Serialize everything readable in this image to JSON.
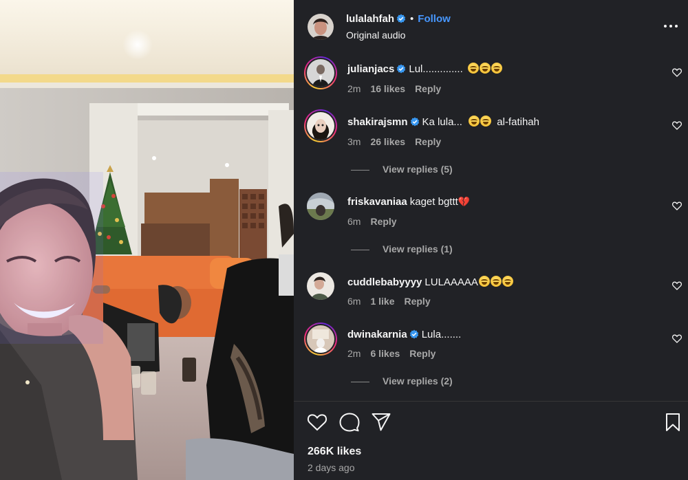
{
  "post": {
    "author": "lulalahfah",
    "author_verified": true,
    "follow_label": "Follow",
    "separator": "•",
    "audio": "Original audio"
  },
  "comments": [
    {
      "username": "julianjacs",
      "verified": true,
      "text": "Lul..............",
      "emojis": 3,
      "time": "2m",
      "likes": "16 likes",
      "reply": "Reply",
      "story_ring": true
    },
    {
      "username": "shakirajsmn",
      "verified": true,
      "text": "Ka lula...",
      "emojis": 2,
      "text_after": "al-fatihah",
      "time": "3m",
      "likes": "26 likes",
      "reply": "Reply",
      "view_replies": "View replies (5)",
      "story_ring": true
    },
    {
      "username": "friskavaniaa",
      "verified": false,
      "text": "kaget bgttt",
      "broken_heart": true,
      "time": "6m",
      "reply": "Reply",
      "view_replies": "View replies (1)",
      "story_ring": false
    },
    {
      "username": "cuddlebabyyyy",
      "verified": false,
      "text": "LULAAAAA",
      "emojis": 3,
      "time": "6m",
      "likes": "1 like",
      "reply": "Reply",
      "story_ring": false
    },
    {
      "username": "dwinakarnia",
      "verified": true,
      "text": "Lula.......",
      "time": "2m",
      "likes": "6 likes",
      "reply": "Reply",
      "view_replies": "View replies (2)",
      "story_ring": true
    }
  ],
  "footer": {
    "likes": "266K likes",
    "posted": "2 days ago"
  },
  "icons": [
    "more-icon",
    "heart-icon",
    "comment-icon",
    "share-icon",
    "bookmark-icon",
    "verified-icon"
  ],
  "colors": {
    "panel": "#212226",
    "accent": "#4797ff",
    "muted": "#a8a8a8",
    "text": "#f5f5f5"
  }
}
